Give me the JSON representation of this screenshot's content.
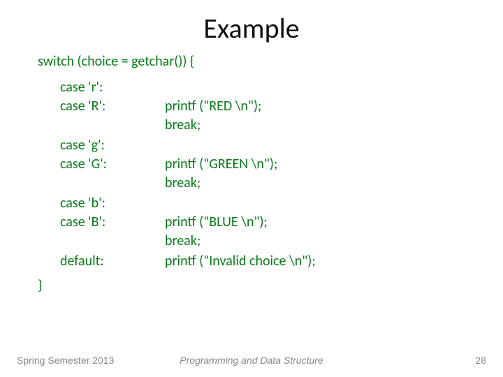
{
  "title": "Example",
  "code": {
    "switch_line": "switch  (choice = getchar())  {",
    "blocks": [
      {
        "cases": [
          "case 'r':",
          "case 'R':"
        ],
        "actions": [
          "printf (\"RED \\n\");",
          "break;"
        ]
      },
      {
        "cases": [
          "case 'g':",
          "case 'G':"
        ],
        "actions": [
          "printf (\"GREEN \\n\");",
          "break;"
        ]
      },
      {
        "cases": [
          "case 'b':",
          "case 'B':"
        ],
        "actions": [
          "printf (\"BLUE \\n\");",
          "break;"
        ]
      },
      {
        "cases": [
          "default:"
        ],
        "actions": [
          "printf (\"Invalid choice \\n\");"
        ]
      }
    ],
    "close_brace": "}"
  },
  "footer": {
    "left": "Spring Semester 2013",
    "center": "Programming and Data Structure",
    "right": "28"
  }
}
